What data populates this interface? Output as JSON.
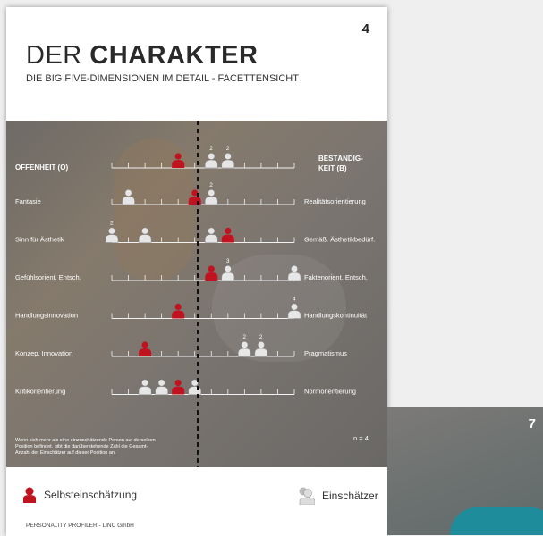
{
  "page": {
    "number": "4",
    "title_light": "DER ",
    "title_bold": "CHARAKTER",
    "subtitle": "DIE BIG FIVE-DIMENSIONEN IM DETAIL - FACETTENSICHT"
  },
  "header": {
    "left": "OFFENHEIT (O)",
    "right_line1": "BESTÄNDIG-",
    "right_line2": "KEIT (B)"
  },
  "rows": [
    {
      "left": "Fantasie",
      "right": "Realitätsorientierung",
      "self": 5,
      "others": [
        {
          "pos": 1,
          "count": ""
        },
        {
          "pos": 5,
          "count": ""
        },
        {
          "pos": 6,
          "count": "2"
        }
      ]
    },
    {
      "left": "Sinn für Ästhetik",
      "right": "Gemäß. Ästhetikbedürf.",
      "self": 7,
      "others": [
        {
          "pos": 0,
          "count": "2"
        },
        {
          "pos": 2,
          "count": ""
        },
        {
          "pos": 6,
          "count": ""
        }
      ]
    },
    {
      "left": "Gefühlsorient. Entsch.",
      "right": "Faktenorient. Entsch.",
      "self": 6,
      "others": [
        {
          "pos": 7,
          "count": "3"
        },
        {
          "pos": 11,
          "count": ""
        }
      ]
    },
    {
      "left": "Handlungsinnovation",
      "right": "Handlungskontinuität",
      "self": 4,
      "others": [
        {
          "pos": 11,
          "count": "4"
        }
      ]
    },
    {
      "left": "Konzep. Innovation",
      "right": "Pragmatismus",
      "self": 2,
      "others": [
        {
          "pos": 8,
          "count": "2"
        },
        {
          "pos": 9,
          "count": "2"
        }
      ]
    },
    {
      "left": "Kritikorientierung",
      "right": "Normorientierung",
      "self": 4,
      "others": [
        {
          "pos": 2,
          "count": ""
        },
        {
          "pos": 3,
          "count": ""
        },
        {
          "pos": 5,
          "count": ""
        }
      ]
    }
  ],
  "top_scale": {
    "self": 4,
    "others": [
      {
        "pos": 6,
        "count": "2"
      },
      {
        "pos": 7,
        "count": "2"
      }
    ]
  },
  "note": [
    "Wenn sich mehr als eine einzuschätzende Person auf derselben",
    "Position befindet, gibt die darüberstehende Zahl die Gesamt-",
    "Anzahl der Einschätzer auf dieser Position an."
  ],
  "n_label": "n = 4",
  "legend": {
    "self": "Selbsteinschätzung",
    "others": "Einschätzer"
  },
  "footer": "PERSONALITY PROFILER - LINC GmbH",
  "colors": {
    "self": "#c1121f",
    "other": "#e6e6e6"
  },
  "page2": {
    "number": "7"
  }
}
